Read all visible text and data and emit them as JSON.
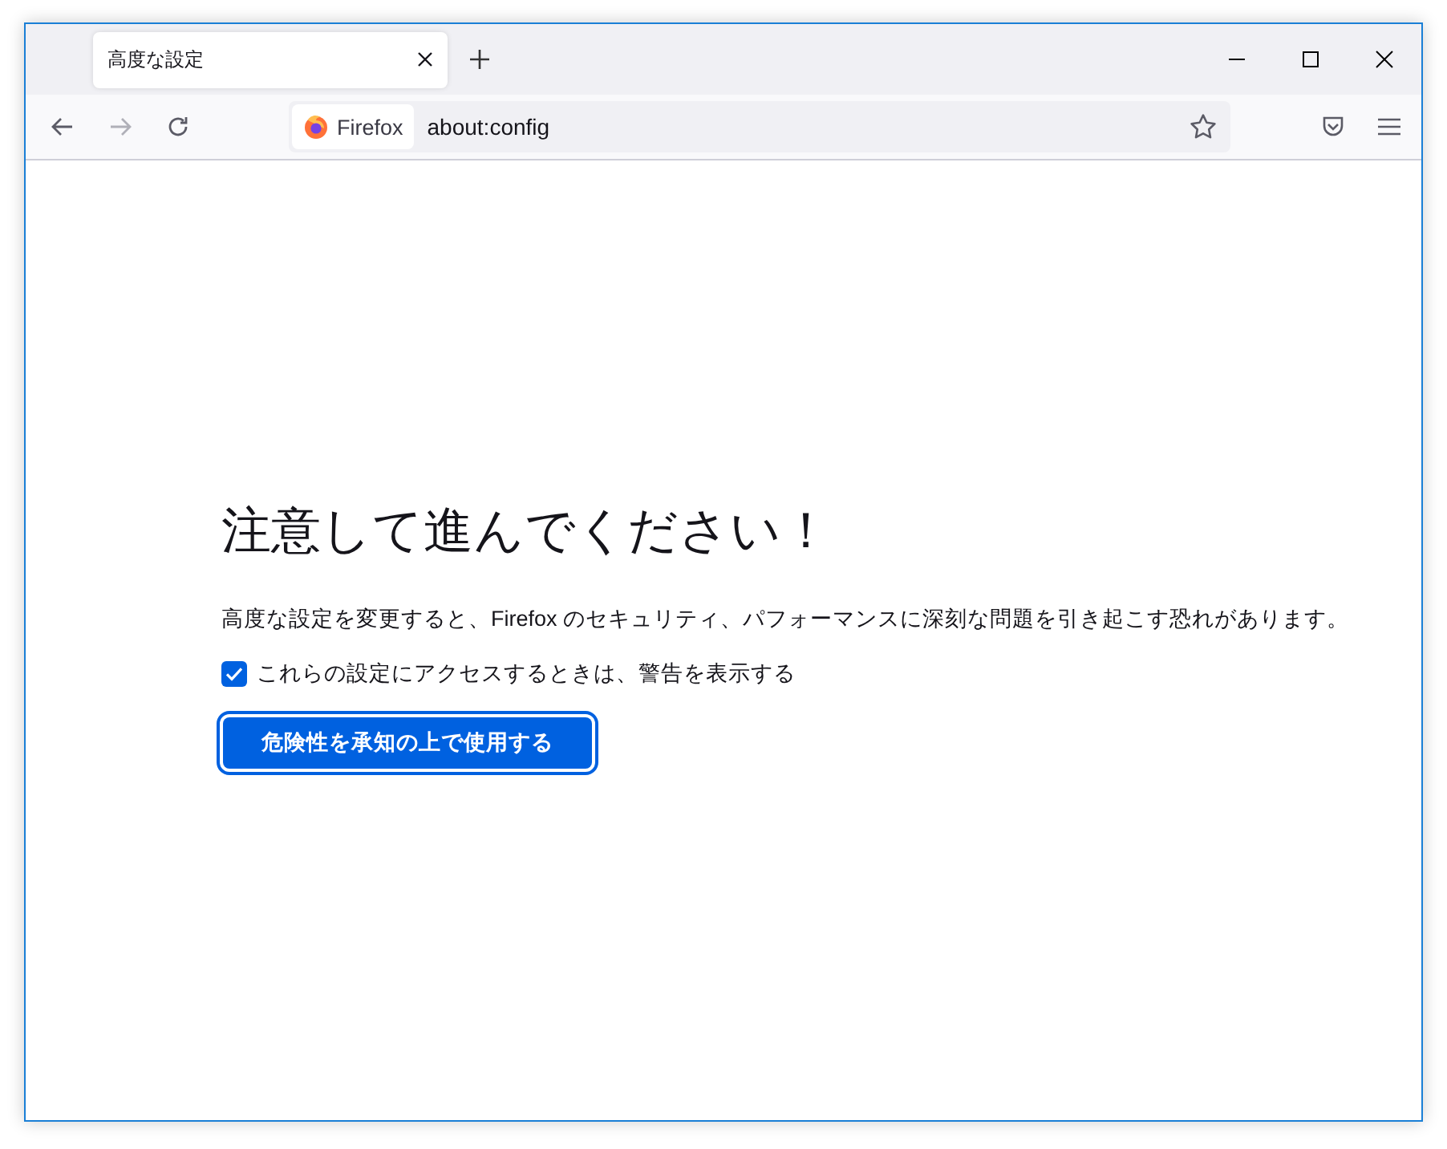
{
  "tabs": [
    {
      "title": "高度な設定",
      "selected": true
    }
  ],
  "nav_buttons": [
    {
      "kind": "back",
      "disabled": false
    },
    {
      "kind": "forward",
      "disabled": true
    },
    {
      "kind": "reload",
      "disabled": false
    }
  ],
  "address_bar": {
    "identity": "Firefox",
    "value": "about:config"
  },
  "page": {
    "heading": "注意して進んでください！",
    "description": "高度な設定を変更すると、Firefox のセキュリティ、パフォーマンスに深刻な問題を引き起こす恐れがあります。",
    "checkbox": {
      "label": "これらの設定にアクセスするときは、警告を表示する",
      "checked": true
    },
    "button": "危険性を承知の上で使用する"
  }
}
